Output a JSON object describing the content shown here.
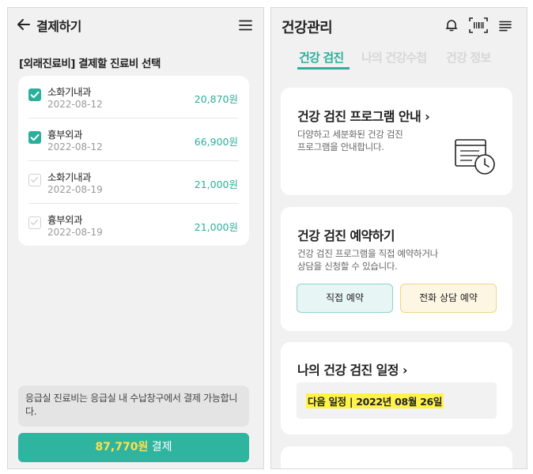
{
  "left_screen": {
    "header": {
      "title": "결제하기",
      "back_icon": "arrow-left-icon",
      "menu_icon": "hamburger-menu-icon"
    },
    "section_title": "[외래진료비] 결제할 진료비 선택",
    "bills": [
      {
        "department": "소화기내과",
        "date": "2022-08-12",
        "amount": "20,870원",
        "checked": true
      },
      {
        "department": "흉부외과",
        "date": "2022-08-12",
        "amount": "66,900원",
        "checked": true
      },
      {
        "department": "소화기내과",
        "date": "2022-08-19",
        "amount": "21,000원",
        "checked": false
      },
      {
        "department": "흉부외과",
        "date": "2022-08-19",
        "amount": "21,000원",
        "checked": false
      }
    ],
    "notice": "응급실 진료비는 응급실 내 수납창구에서 결제 가능합니다.",
    "pay_button": {
      "amount": "87,770원",
      "label": "결제"
    },
    "colors": {
      "accent": "#2aaf9b",
      "pay_amount": "#ffe14a"
    }
  },
  "right_screen": {
    "header": {
      "title": "건강관리",
      "icons": [
        "bell-icon",
        "barcode-scan-icon",
        "list-menu-icon"
      ]
    },
    "tabs": [
      {
        "label": "건강 검진",
        "active": true
      },
      {
        "label": "나의 건강수첩",
        "active": false
      },
      {
        "label": "건강 정보",
        "active": false
      }
    ],
    "program_card": {
      "title": "건강 검진 프로그램 안내 ›",
      "desc_line1": "다양하고 세분화된 건강 검진",
      "desc_line2": "프로그램을 안내합니다.",
      "icon": "schedule-clock-icon"
    },
    "reservation_card": {
      "title": "건강 검진 예약하기",
      "desc_line1": "건강 검진 프로그램을 직접 예약하거나",
      "desc_line2": "상담을 신청할 수 있습니다.",
      "direct_button": "직접 예약",
      "phone_button": "전화 상담 예약"
    },
    "schedule_card": {
      "title": "나의 건강 검진 일정 ›",
      "next_schedule": "다음 일정 | 2022년 08월 26일"
    },
    "colors": {
      "accent": "#2aaf9b",
      "highlight": "#fff34a"
    }
  }
}
